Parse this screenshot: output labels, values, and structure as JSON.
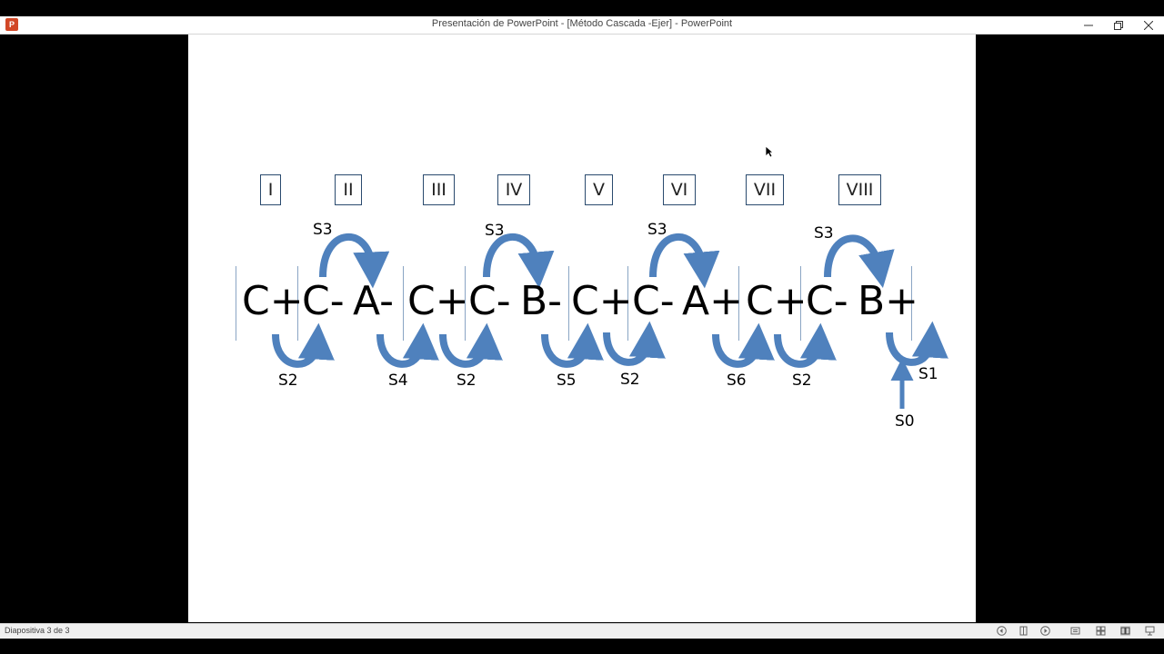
{
  "window": {
    "title": "Presentación de PowerPoint - [Método Cascada -Ejer] - PowerPoint",
    "app_icon": "powerpoint-icon",
    "controls": [
      "minimize-icon",
      "restore-icon",
      "close-icon"
    ]
  },
  "slide": {
    "groups": [
      "I",
      "II",
      "III",
      "IV",
      "V",
      "VI",
      "VII",
      "VIII"
    ],
    "steps": [
      "C+",
      "C-",
      "A-",
      "C+",
      "C-",
      "B-",
      "C+",
      "C-",
      "A+",
      "C+",
      "C-",
      "B+"
    ],
    "top_labels": [
      "S3",
      "S3",
      "S3",
      "S3"
    ],
    "bottom_labels": [
      "S2",
      "S4",
      "S2",
      "S5",
      "S2",
      "S6",
      "S2",
      "S1",
      "S0"
    ],
    "arrow_color": "#4f81bd",
    "arrow_stroke": "#3a6496"
  },
  "statusbar": {
    "slide_position": "Diapositiva 3 de 3",
    "icons": [
      "prev-slide-icon",
      "slide-view-icon",
      "next-slide-icon",
      "normal-view-icon",
      "slide-sorter-icon",
      "reading-view-icon",
      "slideshow-icon"
    ]
  }
}
